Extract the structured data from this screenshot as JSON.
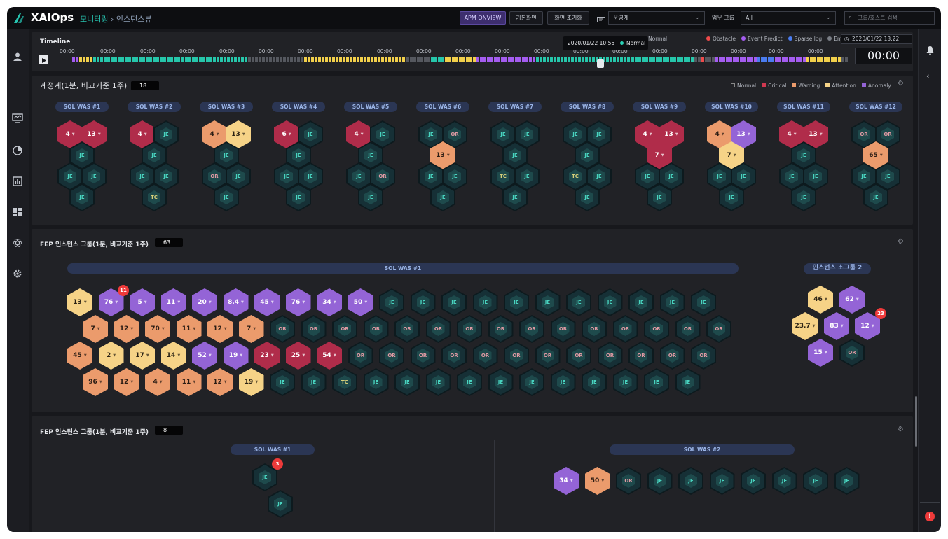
{
  "app": {
    "name": "XAIOps",
    "crumb_section": "모니터링",
    "crumb_sep": "›",
    "crumb_page": "인스턴스뷰"
  },
  "toolbar": {
    "apm_onview": "APM ONVIEW",
    "default_view": "기본화면",
    "reset_view": "화면 초기화",
    "ops_select": "운영계",
    "biz_group_label": "업무 그룹",
    "biz_group_value": "All",
    "search_placeholder": "그룹/호스트 검색"
  },
  "timeline": {
    "title": "Timeline",
    "tick_label": "00:00",
    "tooltip_time": "2020/01/22  10:55",
    "tooltip_status": "Normal",
    "legend_partial": "Normal",
    "legend": [
      {
        "label": "Obstacle",
        "color": "#ee4a4a"
      },
      {
        "label": "Event Predict",
        "color": "#a45cf0"
      },
      {
        "label": "Sparse log",
        "color": "#4a7cf0"
      },
      {
        "label": "Empty",
        "color": "#7a7e86"
      }
    ],
    "datetime": "2020/01/22  13:22",
    "clock": "00:00"
  },
  "legend_status": [
    {
      "label": "Normal",
      "color": "#3a3d44"
    },
    {
      "label": "Critical",
      "color": "#d03850"
    },
    {
      "label": "Warning",
      "color": "#eb9b6c"
    },
    {
      "label": "Attention",
      "color": "#f6d387"
    },
    {
      "label": "Anomaly",
      "color": "#9464d6"
    }
  ],
  "panel1": {
    "title": "계정계(1분, 비교기준 1주)",
    "count": "18",
    "groups": [
      {
        "name": "SOL WAS #1",
        "cells": [
          [
            "crit",
            "4"
          ],
          [
            "crit",
            "13"
          ],
          [
            "je"
          ],
          [
            "je"
          ],
          [
            "je"
          ],
          [
            "je"
          ]
        ]
      },
      {
        "name": "SOL WAS #2",
        "cells": [
          [
            "crit",
            "4"
          ],
          [
            "je"
          ],
          [
            "je"
          ],
          [
            "je"
          ],
          [
            "je"
          ],
          [
            "tc"
          ]
        ]
      },
      {
        "name": "SOL WAS #3",
        "cells": [
          [
            "warn",
            "4"
          ],
          [
            "att",
            "13"
          ],
          [
            "je"
          ],
          [
            "or"
          ],
          [
            "je"
          ],
          [
            "je"
          ]
        ]
      },
      {
        "name": "SOL WAS #4",
        "cells": [
          [
            "crit",
            "6"
          ],
          [
            "je"
          ],
          [
            "je"
          ],
          [
            "je"
          ],
          [
            "je"
          ],
          [
            "je"
          ]
        ]
      },
      {
        "name": "SOL WAS #5",
        "cells": [
          [
            "crit",
            "4"
          ],
          [
            "je"
          ],
          [
            "je"
          ],
          [
            "je"
          ],
          [
            "or"
          ],
          [
            "je"
          ]
        ]
      },
      {
        "name": "SOL WAS #6",
        "cells": [
          [
            "je"
          ],
          [
            "or"
          ],
          [
            "warn",
            "13"
          ],
          [
            "je"
          ],
          [
            "je"
          ],
          [
            "je"
          ]
        ]
      },
      {
        "name": "SOL WAS #7",
        "cells": [
          [
            "je"
          ],
          [
            "je"
          ],
          [
            "je"
          ],
          [
            "tc"
          ],
          [
            "je"
          ],
          [
            "je"
          ]
        ]
      },
      {
        "name": "SOL WAS #8",
        "cells": [
          [
            "je"
          ],
          [
            "je"
          ],
          [
            "je"
          ],
          [
            "tc"
          ],
          [
            "je"
          ],
          [
            "je"
          ]
        ]
      },
      {
        "name": "SOL WAS #9",
        "cells": [
          [
            "crit",
            "4"
          ],
          [
            "crit",
            "13"
          ],
          [
            "crit",
            "7"
          ],
          [
            "je"
          ],
          [
            "je"
          ],
          [
            "je"
          ]
        ]
      },
      {
        "name": "SOL WAS #10",
        "cells": [
          [
            "warn",
            "4"
          ],
          [
            "anom",
            "13"
          ],
          [
            "att",
            "7"
          ],
          [
            "je"
          ],
          [
            "je"
          ],
          [
            "je"
          ]
        ]
      },
      {
        "name": "SOL WAS #11",
        "cells": [
          [
            "crit",
            "4"
          ],
          [
            "crit",
            "13"
          ],
          [
            "je"
          ],
          [
            "je"
          ],
          [
            "je"
          ],
          [
            "je"
          ]
        ]
      },
      {
        "name": "SOL WAS #12",
        "cells": [
          [
            "or"
          ],
          [
            "or"
          ],
          [
            "warn",
            "65"
          ],
          [
            "je"
          ],
          [
            "je"
          ],
          [
            "je"
          ]
        ]
      }
    ]
  },
  "panel2": {
    "title": "FEP 인스턴스 그룹(1분, 비교기준 1주)",
    "count": "63",
    "group_main": "SOL WAS #1",
    "group_sub": "인스턴스 소그룹 2",
    "rows": [
      [
        [
          "att",
          "13"
        ],
        [
          "anom",
          "76"
        ],
        [
          "anom",
          "5"
        ],
        [
          "anom",
          "11"
        ],
        [
          "anom",
          "20"
        ],
        [
          "anom",
          "8.4"
        ],
        [
          "anom",
          "45"
        ],
        [
          "anom",
          "76"
        ],
        [
          "anom",
          "34"
        ],
        [
          "anom",
          "50"
        ],
        [
          "je"
        ],
        [
          "je"
        ],
        [
          "je"
        ],
        [
          "je"
        ],
        [
          "je"
        ],
        [
          "je"
        ],
        [
          "je"
        ],
        [
          "je"
        ],
        [
          "je"
        ],
        [
          "je"
        ],
        [
          "je"
        ]
      ],
      [
        [
          "warn",
          "7"
        ],
        [
          "warn",
          "12"
        ],
        [
          "warn",
          "70"
        ],
        [
          "warn",
          "11"
        ],
        [
          "warn",
          "12"
        ],
        [
          "warn",
          "7"
        ],
        [
          "or"
        ],
        [
          "or"
        ],
        [
          "or"
        ],
        [
          "or"
        ],
        [
          "or"
        ],
        [
          "or"
        ],
        [
          "or"
        ],
        [
          "or"
        ],
        [
          "or"
        ],
        [
          "or"
        ],
        [
          "or"
        ],
        [
          "or"
        ],
        [
          "or"
        ],
        [
          "or"
        ],
        [
          "or"
        ]
      ],
      [
        [
          "warn",
          "45"
        ],
        [
          "att",
          "2"
        ],
        [
          "att",
          "17"
        ],
        [
          "att",
          "14"
        ],
        [
          "anom",
          "52"
        ],
        [
          "anom",
          "19"
        ],
        [
          "crit",
          "23"
        ],
        [
          "crit",
          "25"
        ],
        [
          "crit",
          "54"
        ],
        [
          "or"
        ],
        [
          "or"
        ],
        [
          "or"
        ],
        [
          "or"
        ],
        [
          "or"
        ],
        [
          "or"
        ],
        [
          "or"
        ],
        [
          "or"
        ],
        [
          "or"
        ],
        [
          "or"
        ],
        [
          "or"
        ],
        [
          "or"
        ]
      ],
      [
        [
          "warn",
          "96"
        ],
        [
          "warn",
          "12"
        ],
        [
          "warn",
          "4"
        ],
        [
          "warn",
          "11"
        ],
        [
          "warn",
          "12"
        ],
        [
          "att",
          "19"
        ],
        [
          "je"
        ],
        [
          "je"
        ],
        [
          "tc"
        ],
        [
          "je"
        ],
        [
          "je"
        ],
        [
          "je"
        ],
        [
          "je"
        ],
        [
          "je"
        ],
        [
          "je"
        ],
        [
          "je"
        ],
        [
          "je"
        ],
        [
          "je"
        ],
        [
          "je"
        ],
        [
          "je"
        ]
      ]
    ],
    "badge_main": "11",
    "sub_cells": [
      [
        "att",
        "46"
      ],
      [
        "anom",
        "62"
      ],
      [
        "att",
        "23.7"
      ],
      [
        "anom",
        "83"
      ],
      [
        "anom",
        "12"
      ],
      [
        "anom",
        "15"
      ],
      [
        "or"
      ]
    ],
    "badge_sub": "23"
  },
  "panel3": {
    "title": "FEP 인스턴스 그룹(1분, 비교기준 1주)",
    "count": "8",
    "group_a": "SOL WAS #1",
    "group_b": "SOL WAS #2",
    "a_cells": [
      [
        "je"
      ],
      [
        "je"
      ]
    ],
    "badge_a": "3",
    "b_cells": [
      [
        "anom",
        "34"
      ],
      [
        "warn",
        "50"
      ],
      [
        "or"
      ],
      [
        "je"
      ],
      [
        "je"
      ],
      [
        "je"
      ],
      [
        "je"
      ],
      [
        "je"
      ],
      [
        "je"
      ],
      [
        "je"
      ]
    ]
  },
  "node_labels": {
    "je": "JE",
    "or": "OR",
    "tc": "TC"
  }
}
